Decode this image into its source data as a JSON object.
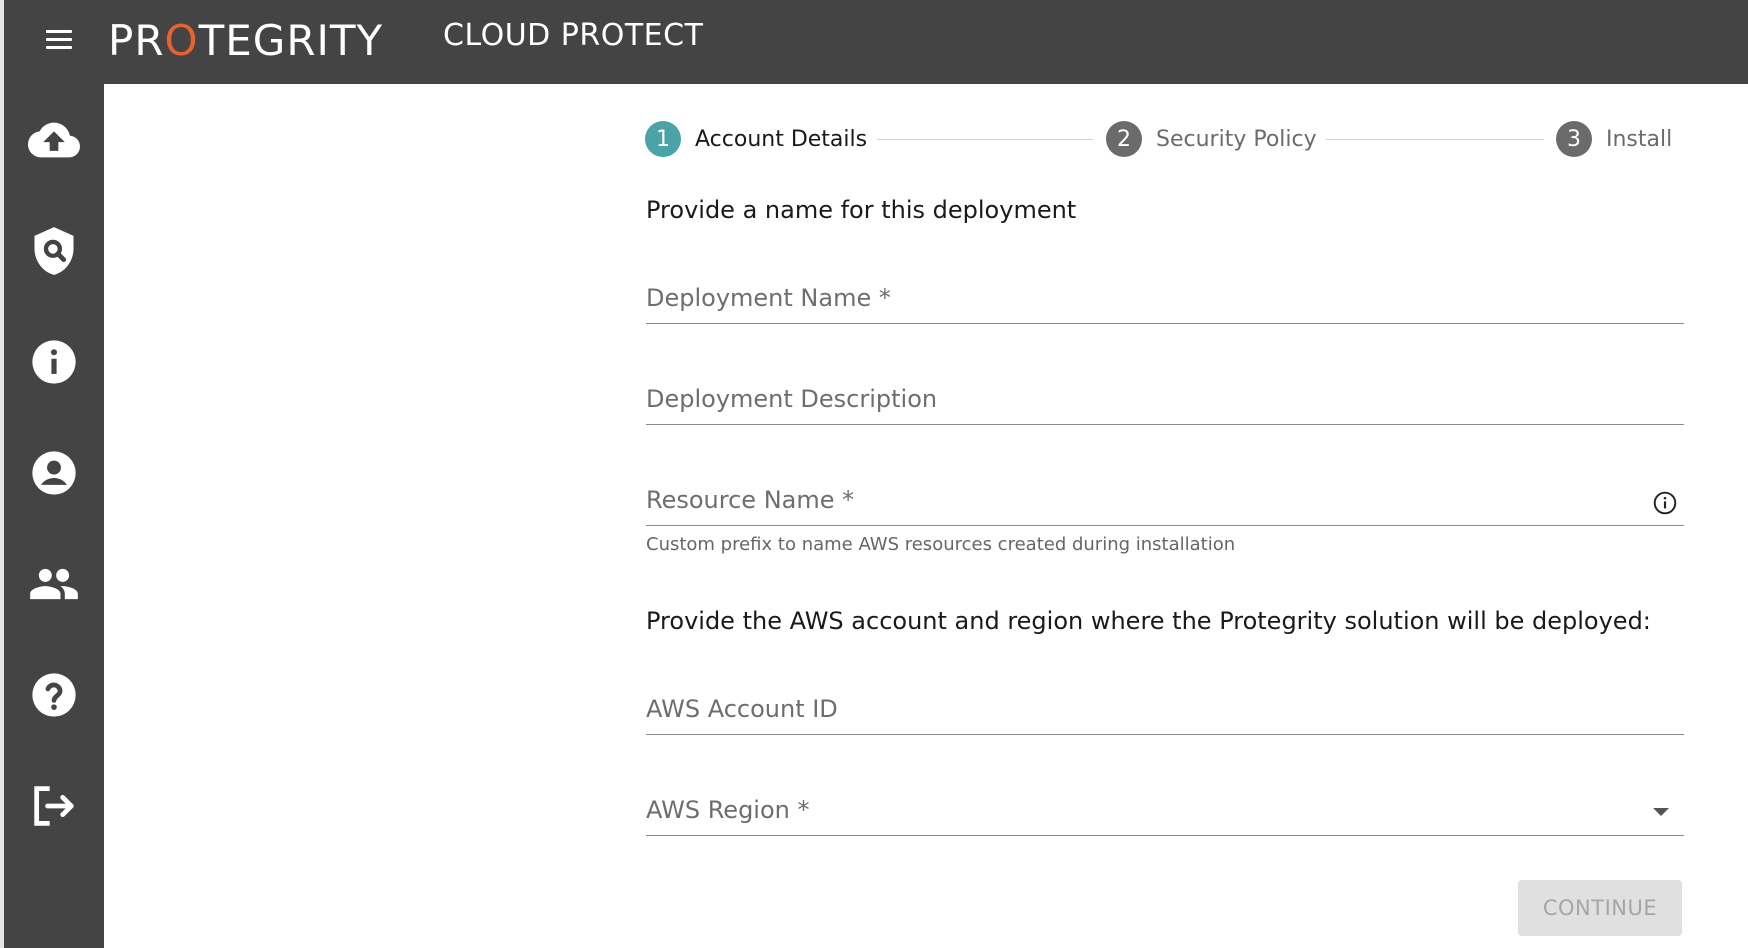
{
  "header": {
    "logo_prefix": "PR",
    "logo_o": "O",
    "logo_suffix": "TEGRITY",
    "product_title": "CLOUD PROTECT"
  },
  "sidebar": {
    "items": [
      {
        "icon": "cloud-upload-icon"
      },
      {
        "icon": "shield-search-icon"
      },
      {
        "icon": "info-icon"
      },
      {
        "icon": "account-circle-icon"
      },
      {
        "icon": "group-icon"
      },
      {
        "icon": "help-icon"
      },
      {
        "icon": "logout-icon"
      }
    ]
  },
  "stepper": {
    "steps": [
      {
        "number": "1",
        "label": "Account Details",
        "state": "active",
        "color": "#4aa3a8"
      },
      {
        "number": "2",
        "label": "Security Policy",
        "state": "inactive",
        "color": "#6b6b6b"
      },
      {
        "number": "3",
        "label": "Install",
        "state": "inactive",
        "color": "#6b6b6b"
      }
    ]
  },
  "form": {
    "heading_name": "Provide a name for this deployment",
    "deployment_name": {
      "placeholder": "Deployment Name *",
      "value": ""
    },
    "deployment_description": {
      "placeholder": "Deployment Description",
      "value": ""
    },
    "resource_name": {
      "placeholder": "Resource Name *",
      "value": "",
      "hint": "Custom prefix to name AWS resources created during installation"
    },
    "heading_aws": "Provide the AWS account and region where the Protegrity solution will be deployed:",
    "aws_account_id": {
      "placeholder": "AWS Account ID",
      "value": ""
    },
    "aws_region": {
      "placeholder": "AWS Region *",
      "value": ""
    },
    "continue_label": "CONTINUE"
  },
  "colors": {
    "header_bg": "#444444",
    "brand_orange": "#e8622e",
    "active_step": "#4aa3a8",
    "disabled_button_bg": "#e0e0e0"
  }
}
